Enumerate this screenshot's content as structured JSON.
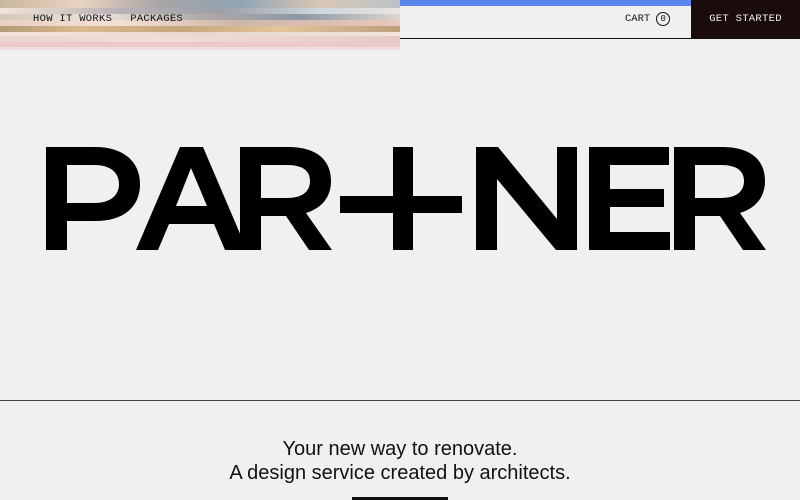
{
  "nav": {
    "items": [
      {
        "label": "HOW IT WORKS"
      },
      {
        "label": "PACKAGES"
      }
    ]
  },
  "header": {
    "cart_label": "CART",
    "cart_count": "0",
    "cta_label": "GET STARTED"
  },
  "hero": {
    "logo_text": "PARTNER"
  },
  "tagline": {
    "line1": "Your new way to renovate.",
    "line2": "A design service created by architects."
  },
  "colors": {
    "accent_blue": "#5b86ee",
    "cta_bg": "#1b0c0c",
    "page_bg": "#f1f0f0"
  }
}
